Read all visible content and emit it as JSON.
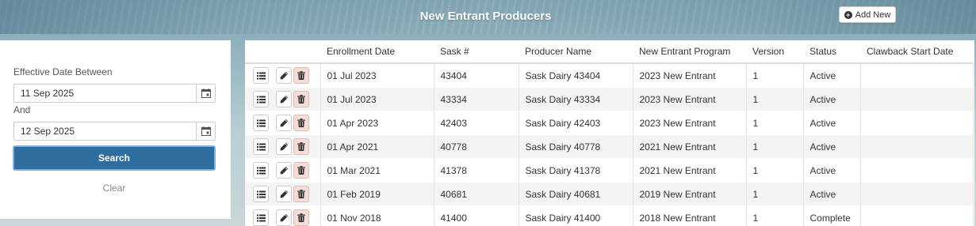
{
  "header": {
    "title": "New Entrant Producers",
    "add_label": "Add New"
  },
  "filter": {
    "label_between": "Effective Date Between",
    "from_value": "11 Sep 2025",
    "label_and": "And",
    "to_value": "12 Sep 2025",
    "search_label": "Search",
    "clear_label": "Clear"
  },
  "table": {
    "columns": [
      "Enrollment Date",
      "Sask #",
      "Producer Name",
      "New Entrant Program",
      "Version",
      "Status",
      "Clawback Start Date"
    ],
    "rows": [
      {
        "enrollment": "01 Jul 2023",
        "sask": "43404",
        "producer": "Sask Dairy 43404",
        "program": "2023 New Entrant",
        "version": "1",
        "status": "Active",
        "clawback": ""
      },
      {
        "enrollment": "01 Jul 2023",
        "sask": "43334",
        "producer": "Sask Dairy 43334",
        "program": "2023 New Entrant",
        "version": "1",
        "status": "Active",
        "clawback": ""
      },
      {
        "enrollment": "01 Apr 2023",
        "sask": "42403",
        "producer": "Sask Dairy 42403",
        "program": "2023 New Entrant",
        "version": "1",
        "status": "Active",
        "clawback": ""
      },
      {
        "enrollment": "01 Apr 2021",
        "sask": "40778",
        "producer": "Sask Dairy 40778",
        "program": "2021 New Entrant",
        "version": "1",
        "status": "Active",
        "clawback": ""
      },
      {
        "enrollment": "01 Mar 2021",
        "sask": "41378",
        "producer": "Sask Dairy 41378",
        "program": "2021 New Entrant",
        "version": "1",
        "status": "Active",
        "clawback": ""
      },
      {
        "enrollment": "01 Feb 2019",
        "sask": "40681",
        "producer": "Sask Dairy 40681",
        "program": "2019 New Entrant",
        "version": "1",
        "status": "Active",
        "clawback": ""
      },
      {
        "enrollment": "01 Nov 2018",
        "sask": "41400",
        "producer": "Sask Dairy 41400",
        "program": "2018 New Entrant",
        "version": "1",
        "status": "Complete",
        "clawback": ""
      }
    ]
  },
  "icons": {
    "plus": "plus-circle-icon",
    "calendar": "calendar-icon",
    "details": "list-icon",
    "edit": "pencil-icon",
    "delete": "trash-icon"
  },
  "colors": {
    "primary_button": "#2f6d9f",
    "delete_button": "#f5dcd7"
  }
}
